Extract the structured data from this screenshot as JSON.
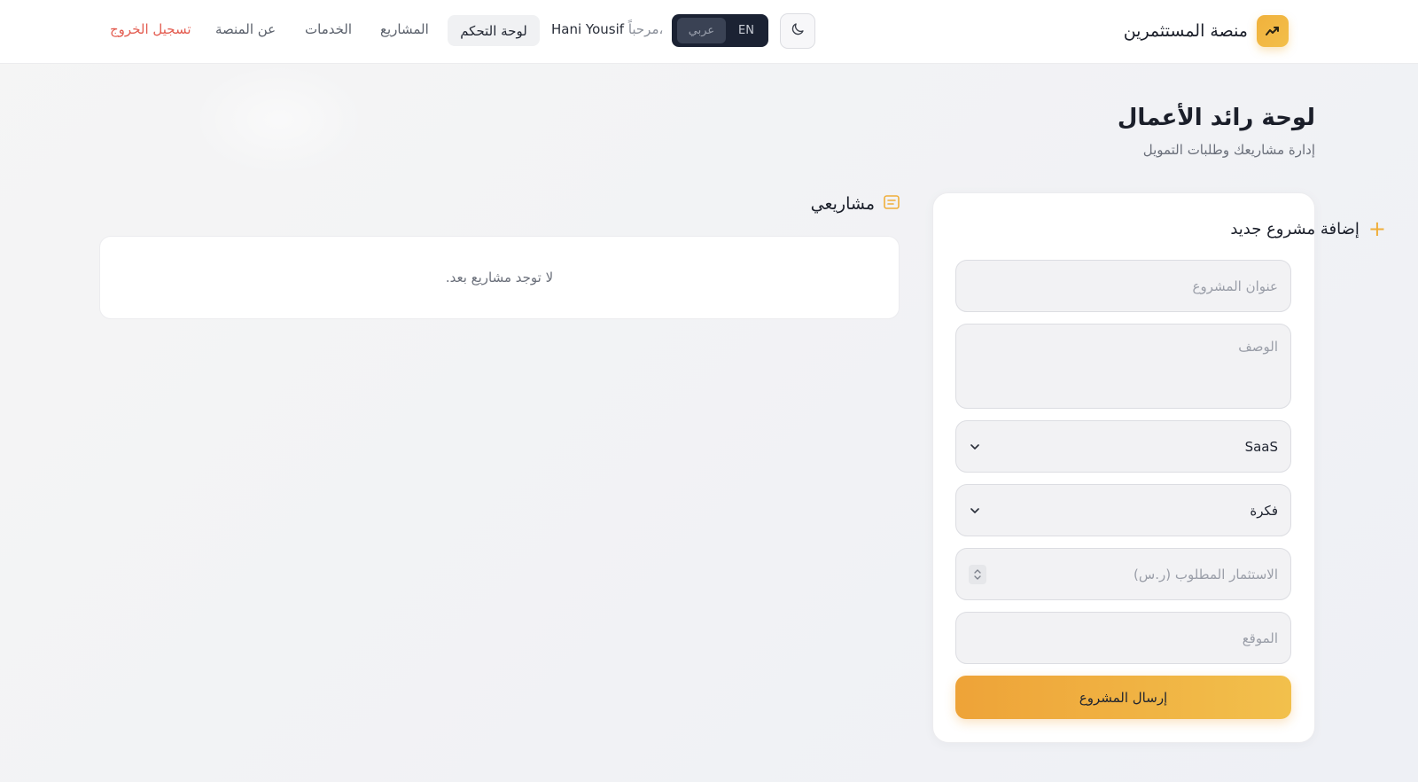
{
  "header": {
    "brand_name": "منصة المستثمرين",
    "brand_icon": "trend-chart-icon",
    "theme_icon": "moon-icon",
    "lang_en": "EN",
    "lang_ar": "عربي",
    "greeting": "مرحباً،",
    "user_name": "Hani Yousif",
    "nav": {
      "dashboard": "لوحة التحكم",
      "projects": "المشاريع",
      "services": "الخدمات",
      "about": "عن المنصة",
      "logout": "تسجيل الخروج"
    }
  },
  "page": {
    "title": "لوحة رائد الأعمال",
    "subtitle": "إدارة مشاريعك وطلبات التمويل"
  },
  "form": {
    "title": "إضافة مشروع جديد",
    "icon": "plus-icon",
    "project_title_placeholder": "عنوان المشروع",
    "description_placeholder": "الوصف",
    "category_value": "SaaS",
    "stage_value": "فكرة",
    "investment_placeholder": "الاستثمار المطلوب (ر.س)",
    "location_placeholder": "الموقع",
    "submit_label": "إرسال المشروع"
  },
  "projects": {
    "title": "مشاريعي",
    "icon": "list-icon",
    "empty_message": "لا توجد مشاريع بعد."
  },
  "colors": {
    "accent": "#efae3a",
    "logout": "#e35b4f",
    "dark_toggle": "#1b2233"
  }
}
